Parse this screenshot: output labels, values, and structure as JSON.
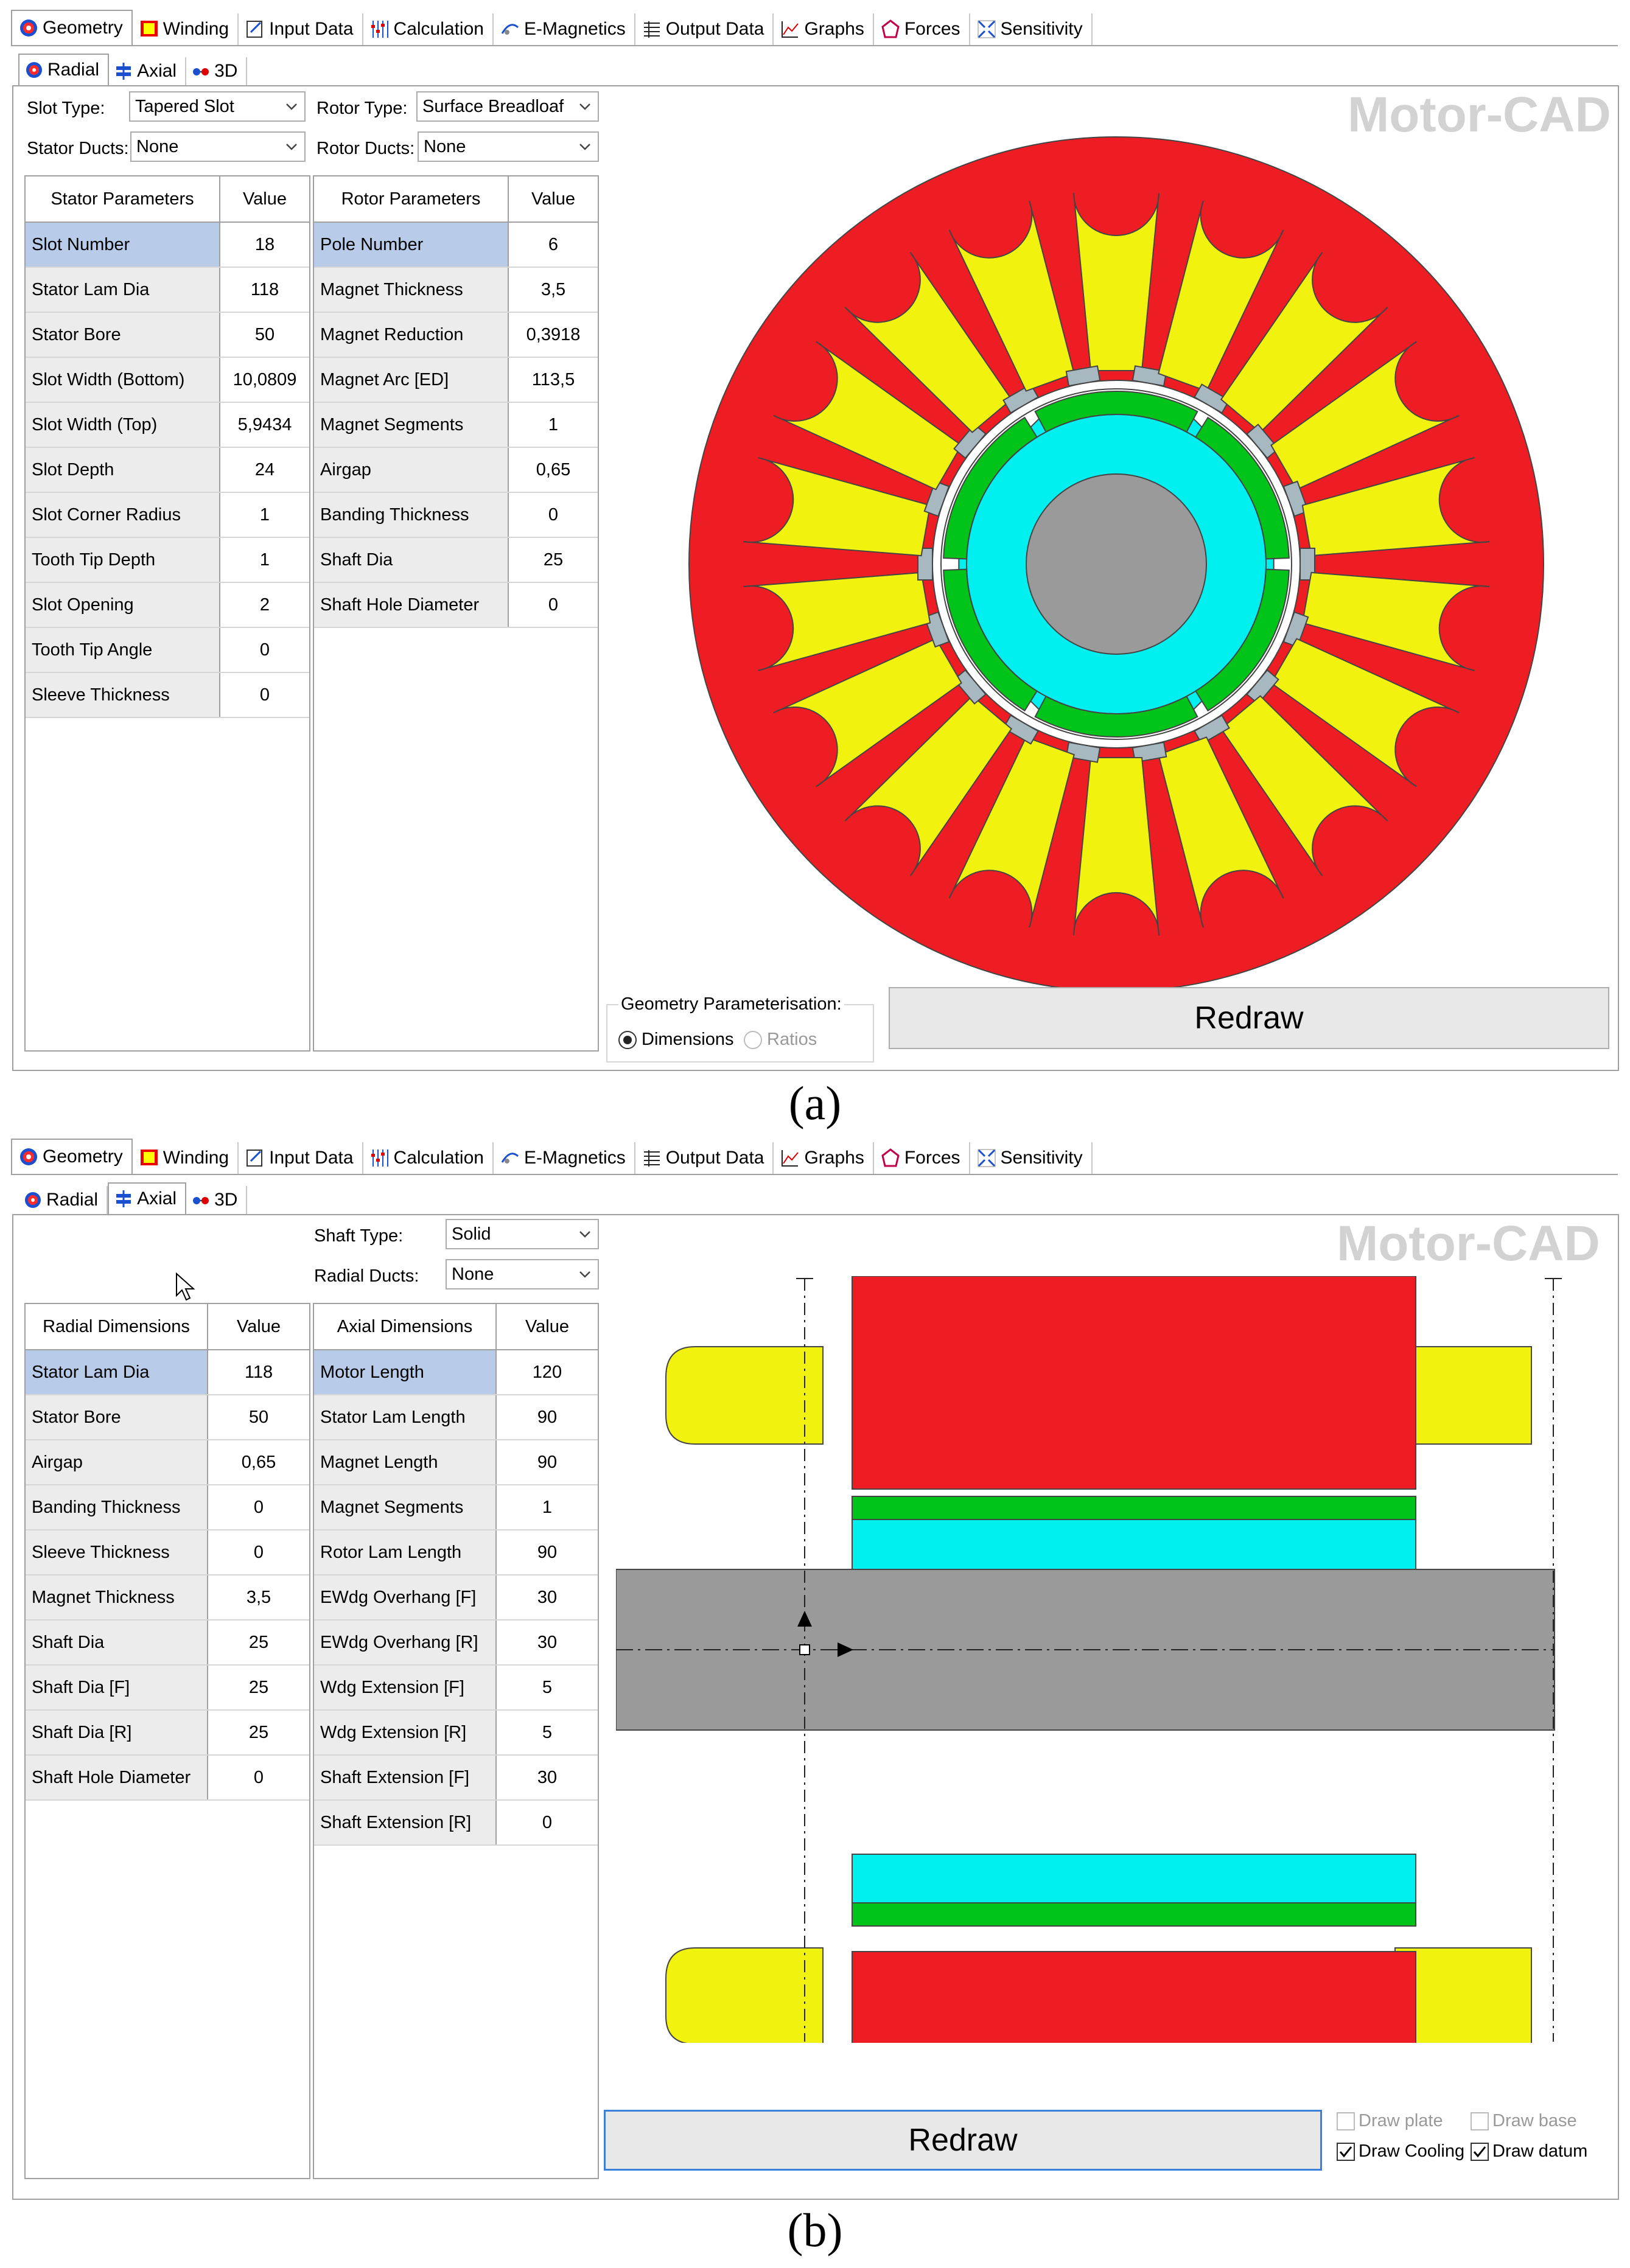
{
  "tabs": [
    "Geometry",
    "Winding",
    "Input Data",
    "Calculation",
    "E-Magnetics",
    "Output Data",
    "Graphs",
    "Forces",
    "Sensitivity"
  ],
  "subtabs": [
    "Radial",
    "Axial",
    "3D"
  ],
  "logo": "Motor-CAD",
  "redraw_label": "Redraw",
  "colors": {
    "stator": "#ee1c23",
    "winding": "#f2f20f",
    "rotor": "#00f0f0",
    "magnet": "#00c419",
    "shaft": "#9a9a9a",
    "tooth_tip": "#a8b8c0"
  },
  "panel_a": {
    "caption": "(a)",
    "slot_type_label": "Slot Type:",
    "slot_type_value": "Tapered Slot",
    "rotor_type_label": "Rotor Type:",
    "rotor_type_value": "Surface Breadloaf",
    "stator_ducts_label": "Stator Ducts:",
    "stator_ducts_value": "None",
    "rotor_ducts_label": "Rotor Ducts:",
    "rotor_ducts_value": "None",
    "stator_table": {
      "headers": [
        "Stator Parameters",
        "Value"
      ],
      "rows": [
        [
          "Slot Number",
          "18"
        ],
        [
          "Stator Lam Dia",
          "118"
        ],
        [
          "Stator Bore",
          "50"
        ],
        [
          "Slot Width (Bottom)",
          "10,0809"
        ],
        [
          "Slot Width (Top)",
          "5,9434"
        ],
        [
          "Slot Depth",
          "24"
        ],
        [
          "Slot Corner Radius",
          "1"
        ],
        [
          "Tooth Tip Depth",
          "1"
        ],
        [
          "Slot Opening",
          "2"
        ],
        [
          "Tooth Tip Angle",
          "0"
        ],
        [
          "Sleeve Thickness",
          "0"
        ]
      ]
    },
    "rotor_table": {
      "headers": [
        "Rotor Parameters",
        "Value"
      ],
      "rows": [
        [
          "Pole Number",
          "6"
        ],
        [
          "Magnet Thickness",
          "3,5"
        ],
        [
          "Magnet Reduction",
          "0,3918"
        ],
        [
          "Magnet Arc [ED]",
          "113,5"
        ],
        [
          "Magnet Segments",
          "1"
        ],
        [
          "Airgap",
          "0,65"
        ],
        [
          "Banding Thickness",
          "0"
        ],
        [
          "Shaft Dia",
          "25"
        ],
        [
          "Shaft Hole Diameter",
          "0"
        ]
      ]
    },
    "geometry_param_label": "Geometry Parameterisation:",
    "option_dimensions": "Dimensions",
    "option_ratios": "Ratios"
  },
  "panel_b": {
    "caption": "(b)",
    "shaft_type_label": "Shaft Type:",
    "shaft_type_value": "Solid",
    "radial_ducts_label": "Radial Ducts:",
    "radial_ducts_value": "None",
    "radial_table": {
      "headers": [
        "Radial Dimensions",
        "Value"
      ],
      "rows": [
        [
          "Stator Lam Dia",
          "118"
        ],
        [
          "Stator Bore",
          "50"
        ],
        [
          "Airgap",
          "0,65"
        ],
        [
          "Banding Thickness",
          "0"
        ],
        [
          "Sleeve Thickness",
          "0"
        ],
        [
          "Magnet Thickness",
          "3,5"
        ],
        [
          "Shaft Dia",
          "25"
        ],
        [
          "Shaft Dia [F]",
          "25"
        ],
        [
          "Shaft Dia [R]",
          "25"
        ],
        [
          "Shaft Hole Diameter",
          "0"
        ]
      ]
    },
    "axial_table": {
      "headers": [
        "Axial Dimensions",
        "Value"
      ],
      "rows": [
        [
          "Motor Length",
          "120"
        ],
        [
          "Stator Lam Length",
          "90"
        ],
        [
          "Magnet Length",
          "90"
        ],
        [
          "Magnet Segments",
          "1"
        ],
        [
          "Rotor Lam Length",
          "90"
        ],
        [
          "EWdg Overhang [F]",
          "30"
        ],
        [
          "EWdg Overhang [R]",
          "30"
        ],
        [
          "Wdg Extension [F]",
          "5"
        ],
        [
          "Wdg Extension [R]",
          "5"
        ],
        [
          "Shaft Extension [F]",
          "30"
        ],
        [
          "Shaft Extension [R]",
          "0"
        ]
      ]
    },
    "draw_plate": "Draw plate",
    "draw_base": "Draw base",
    "draw_cooling": "Draw Cooling",
    "draw_datum": "Draw datum"
  }
}
